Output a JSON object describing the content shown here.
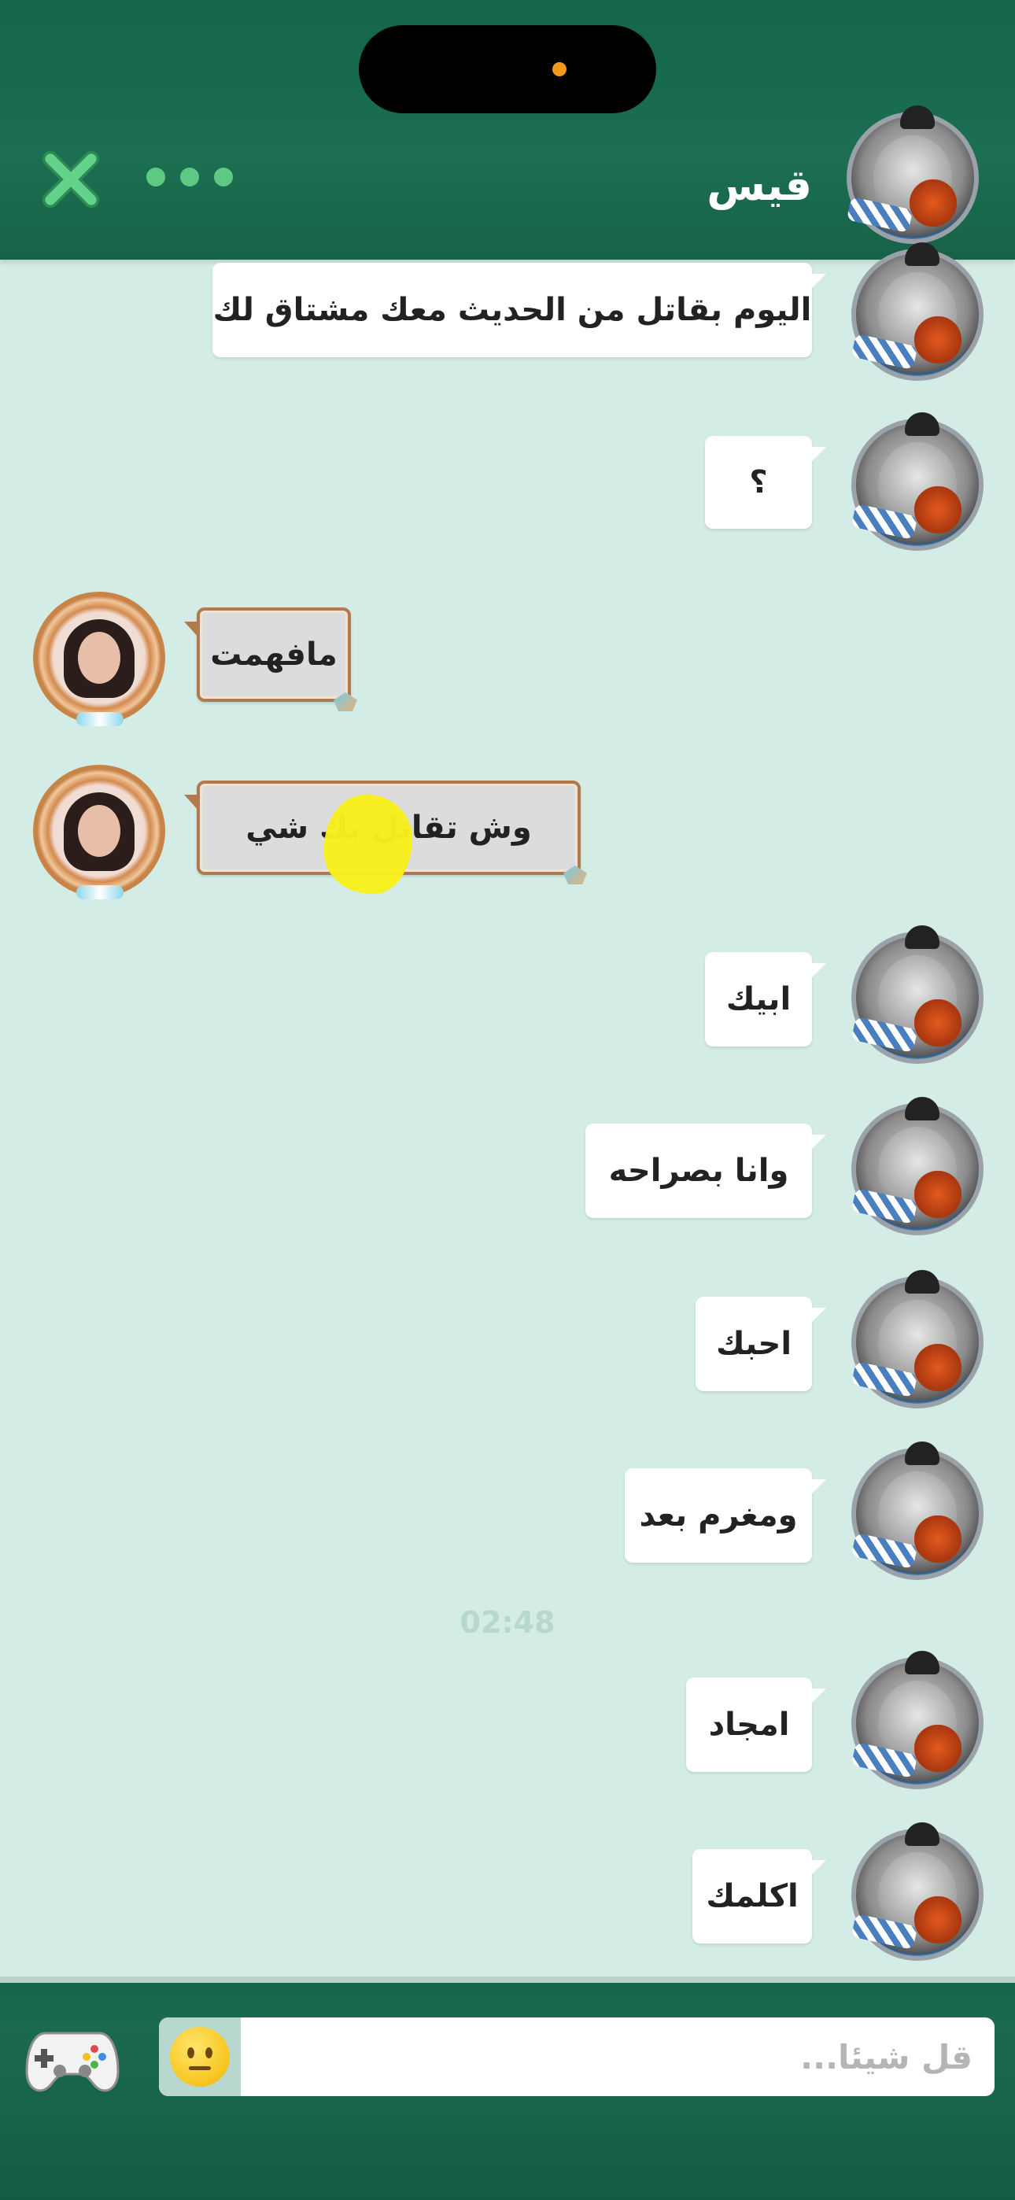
{
  "header": {
    "contact_name": "قيس",
    "close_icon": "close-icon",
    "more_icon": "more-dots-icon"
  },
  "messages": [
    {
      "side": "out",
      "text": "اليوم بقاتل من الحديث معك مشتاق لك"
    },
    {
      "side": "out",
      "text": "؟"
    },
    {
      "side": "in",
      "text": "مافهمت"
    },
    {
      "side": "in",
      "text": "وش تقاتل بك شي"
    },
    {
      "side": "out",
      "text": "ابيك"
    },
    {
      "side": "out",
      "text": "وانا بصراحه"
    },
    {
      "side": "out",
      "text": "احبك"
    },
    {
      "side": "out",
      "text": "ومغرم بعد"
    },
    {
      "side": "out",
      "text": "امجاد"
    },
    {
      "side": "out",
      "text": "اكلمك"
    }
  ],
  "timestamp": "02:48",
  "footer": {
    "input_placeholder": "قل شيئا...",
    "emoji_icon": "emoji-face-icon",
    "game_icon": "gamepad-icon"
  },
  "colors": {
    "header_green": "#14654b",
    "chat_bg": "#d3ece5",
    "accent_green": "#5ec983",
    "notch_dot": "#f19a1c"
  }
}
